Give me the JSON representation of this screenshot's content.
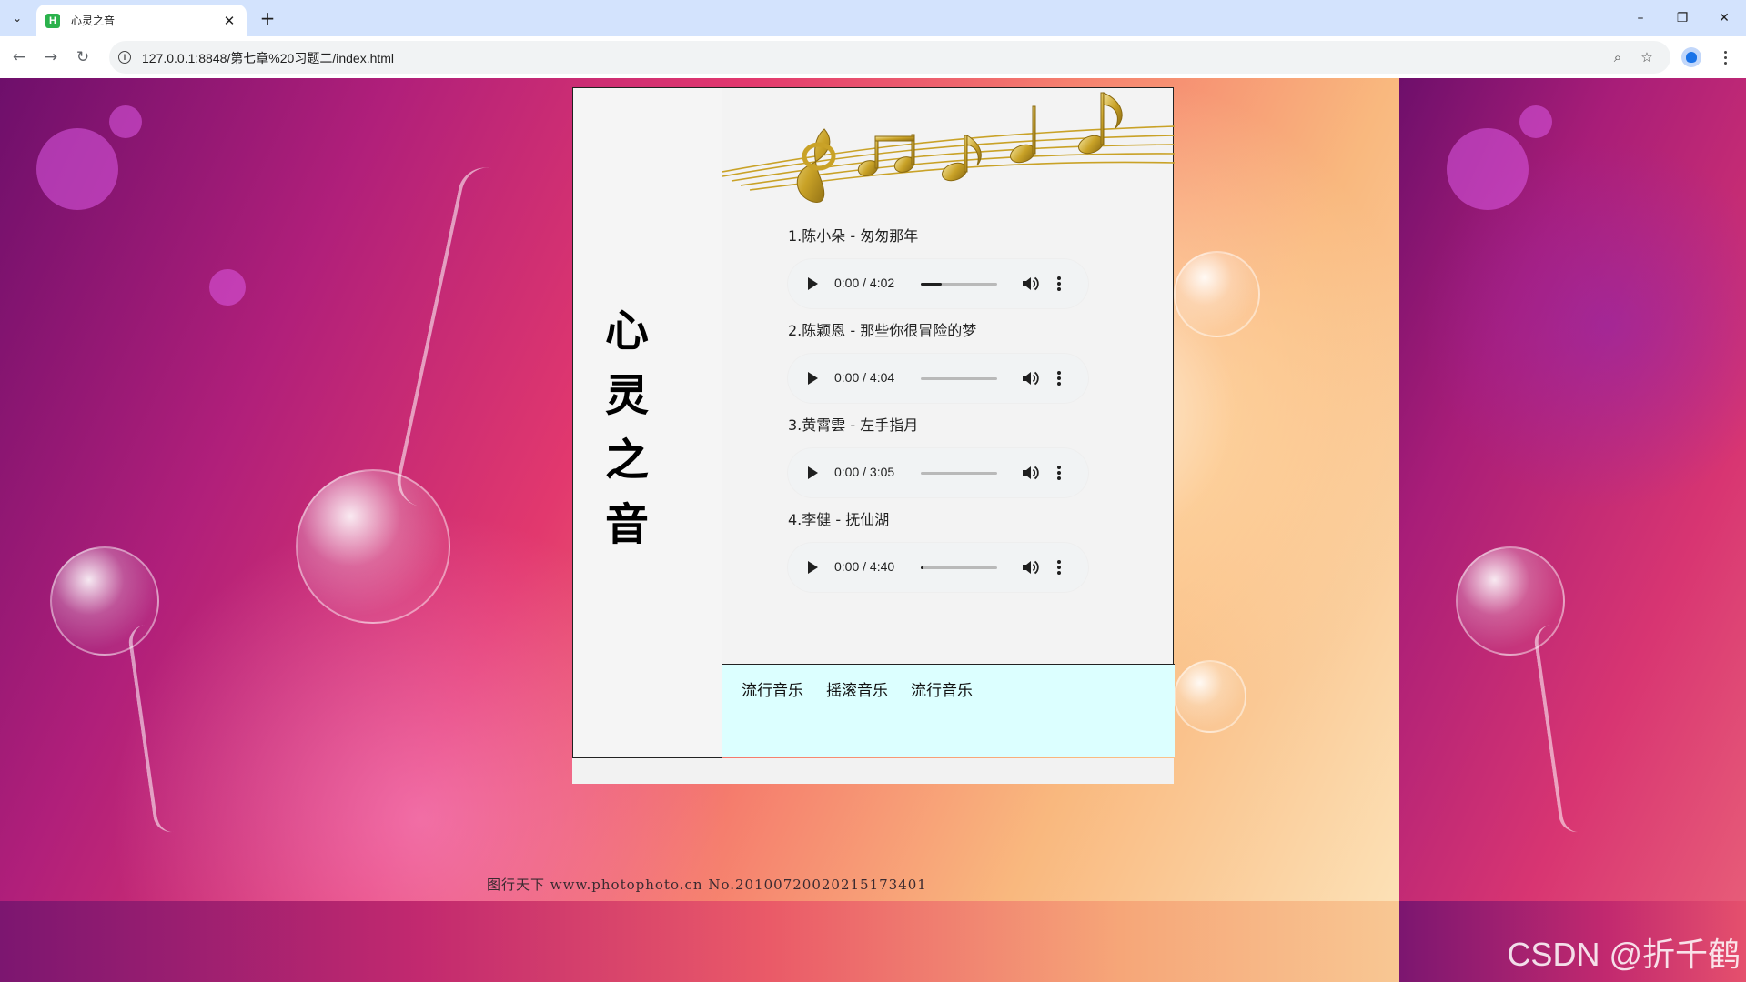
{
  "browser": {
    "tab_title": "心灵之音",
    "favicon_letter": "H",
    "tab_close": "✕",
    "new_tab": "+",
    "url": "127.0.0.1:8848/第七章%20习题二/index.html",
    "window": {
      "minimize": "–",
      "restore": "❐",
      "close": "✕"
    },
    "nav": {
      "back": "←",
      "forward": "→",
      "reload": "↻"
    },
    "zoom_icon": "⌕",
    "bookmark_icon": "☆",
    "tab_search_icon": "⌄"
  },
  "page": {
    "title_chars": [
      "心",
      "灵",
      "之",
      "音"
    ],
    "songs": [
      {
        "title": "1.陈小朵 - 匆匆那年",
        "time": "0:00 / 4:02",
        "progress": 0.27
      },
      {
        "title": "2.陈颖恩 - 那些你很冒险的梦",
        "time": "0:00 / 4:04",
        "progress": 0
      },
      {
        "title": "3.黄霄雲 - 左手指月",
        "time": "0:00 / 3:05",
        "progress": 0
      },
      {
        "title": "4.李健 - 抚仙湖",
        "time": "0:00 / 4:40",
        "progress": 0.03
      }
    ],
    "footer_links": [
      "流行音乐",
      "摇滚音乐",
      "流行音乐"
    ]
  },
  "background": {
    "watermark": "图行天下 www.photophoto.cn No.20100720020215173401",
    "csdn": "CSDN @折千鹤"
  },
  "colors": {
    "footer_bg": "#dcffff",
    "tabstrip_bg": "#d3e3fd",
    "music_gold": "#c9a227"
  }
}
